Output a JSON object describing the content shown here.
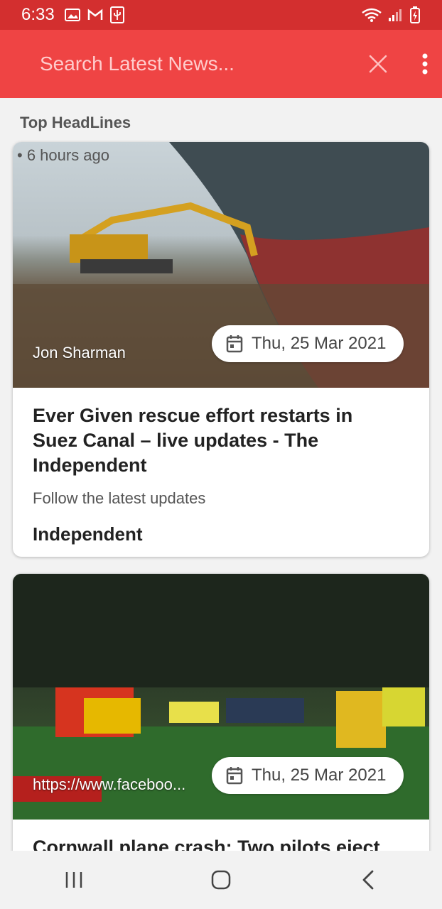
{
  "status_bar": {
    "time": "6:33"
  },
  "app_bar": {
    "search_placeholder": "Search Latest News...",
    "accent_color": "#ef4444"
  },
  "section_title": "Top HeadLines",
  "articles": [
    {
      "time_ago": "• 6 hours ago",
      "author": "Jon Sharman",
      "date": "Thu, 25 Mar 2021",
      "headline": "Ever Given rescue effort restarts in Suez Canal – live updates - The Independent",
      "description": "Follow the latest updates",
      "source": "Independent"
    },
    {
      "author": "https://www.faceboo...",
      "date": "Thu, 25 Mar 2021",
      "headline": "Cornwall plane crash: Two pilots eject"
    }
  ]
}
